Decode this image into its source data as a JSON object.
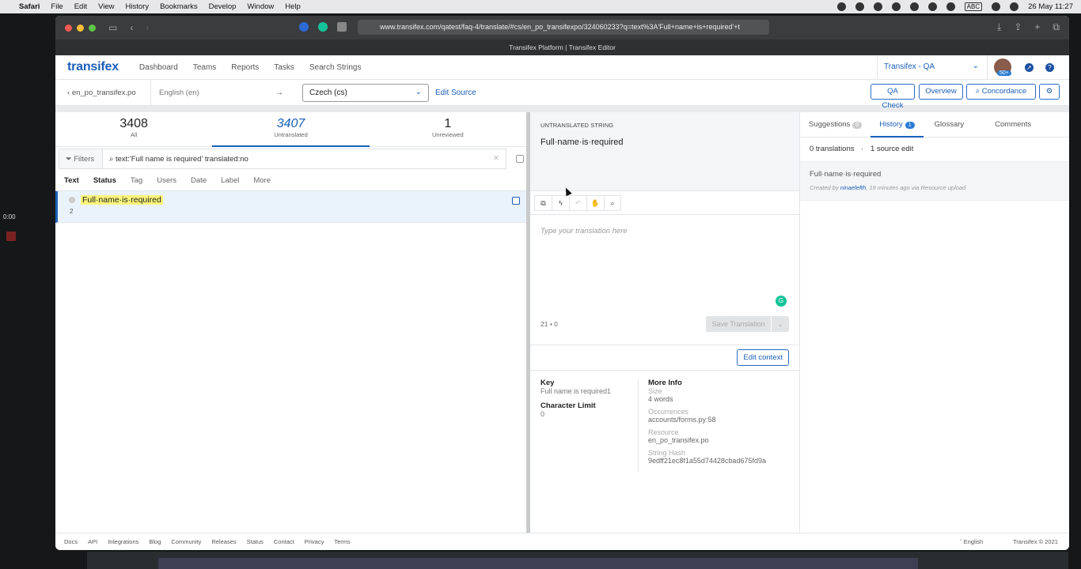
{
  "menubar": {
    "app": "Safari",
    "items": [
      "File",
      "Edit",
      "View",
      "History",
      "Bookmarks",
      "Develop",
      "Window",
      "Help"
    ],
    "keyboard": "ABC",
    "datetime": "26 May  11:27"
  },
  "recording": {
    "timer": "0:00"
  },
  "browser": {
    "url": "www.transifex.com/qatest/faq-4/translate/#cs/en_po_transifexpo/324060233?q=text%3A'Full+name+is+required'+t",
    "tab_title": "Transifex Platform | Transifex Editor"
  },
  "topnav": {
    "logo": "transifex",
    "items": [
      "Dashboard",
      "Teams",
      "Reports",
      "Tasks",
      "Search Strings"
    ],
    "project": "Transifex - QA",
    "avatar_badge": "50+",
    "compass_icon": "compass-icon",
    "help_icon": "help-icon"
  },
  "toolbar": {
    "resource": "en_po_transifex.po",
    "source_language": "English (en)",
    "arrow": "→",
    "target_language": "Czech (cs)",
    "edit_source": "Edit Source",
    "qa_check": "QA Check",
    "overview": "Overview",
    "concordance": "Concordance"
  },
  "stats": [
    {
      "num": "3408",
      "label": "All"
    },
    {
      "num": "3407",
      "label": "Untranslated"
    },
    {
      "num": "1",
      "label": "Unreviewed"
    }
  ],
  "filters": {
    "button": "Filters",
    "query": "text:'Full name is required' translated:no",
    "columns": [
      "Text",
      "Status",
      "Tag",
      "Users",
      "Date",
      "Label",
      "More"
    ]
  },
  "string_row": {
    "text": "Full·name·is·required",
    "word_count": "2"
  },
  "editor": {
    "header": "UNTRANSLATED STRING",
    "source_text": "Full·name·is·required",
    "placeholder": "Type your translation here",
    "counter": "21 • 0",
    "save_label": "Save Translation",
    "edit_context": "Edit context"
  },
  "info": {
    "key_label": "Key",
    "key_value": "Full name is required1",
    "char_limit_label": "Character Limit",
    "char_limit_value": "0",
    "more_info_label": "More Info",
    "size_label": "Size",
    "size_value": "4 words",
    "occurrences_label": "Occurrences",
    "occurrences_value": "accounts/forms.py:58",
    "resource_label": "Resource",
    "resource_value": "en_po_transifex.po",
    "hash_label": "String Hash",
    "hash_value": "9edff21ec8f1a55d74428cbad675fd9a"
  },
  "right_tabs": [
    {
      "label": "Suggestions",
      "count": "0"
    },
    {
      "label": "History",
      "count": "1"
    },
    {
      "label": "Glossary",
      "count": ""
    },
    {
      "label": "Comments",
      "count": ""
    }
  ],
  "history": {
    "summary_a": "0 translations",
    "summary_sep": "·",
    "summary_b": "1 source edit",
    "item_text": "Full·name·is·required",
    "item_meta_pre": "Created by ",
    "item_user": "ninaelefth",
    "item_meta_post": ", 19 minutes ago via Resource upload"
  },
  "footer": {
    "links": [
      "Docs",
      "API",
      "Integrations",
      "Blog",
      "Community",
      "Releases",
      "Status",
      "Contact",
      "Privacy",
      "Terms"
    ],
    "language": "English",
    "copyright": "Transifex © 2021"
  }
}
